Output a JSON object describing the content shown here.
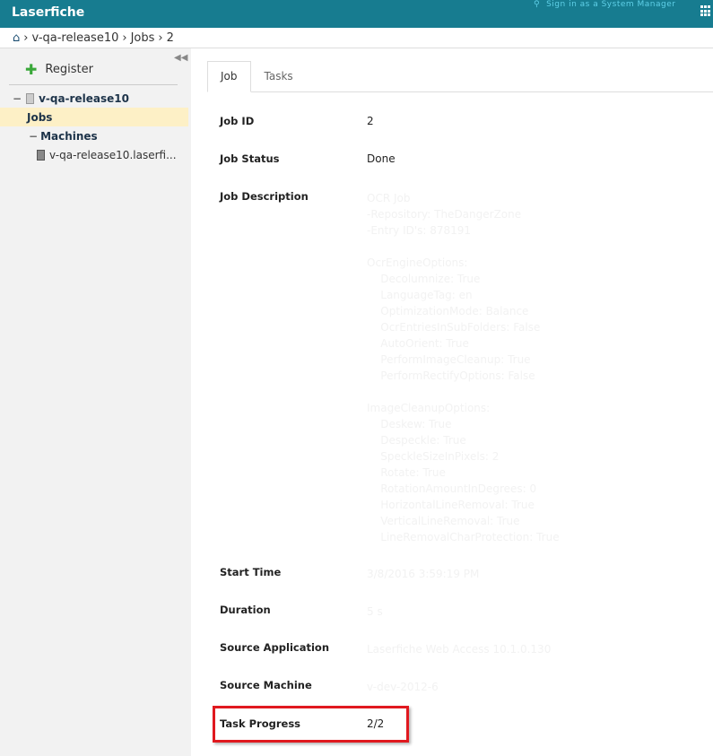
{
  "header": {
    "logo": "Laserfiche",
    "sign_in": "Sign in as a System Manager"
  },
  "breadcrumb": [
    "v-qa-release10",
    "Jobs",
    "2"
  ],
  "sidebar": {
    "register": "Register",
    "tree": {
      "server": "v-qa-release10",
      "jobs": "Jobs",
      "machines": "Machines",
      "machine": "v-qa-release10.laserfi..."
    }
  },
  "tabs": [
    "Job",
    "Tasks"
  ],
  "fields": {
    "job_id": {
      "label": "Job ID",
      "value": "2"
    },
    "job_status": {
      "label": "Job Status",
      "value": "Done"
    },
    "job_description": {
      "label": "Job Description",
      "value": "OCR Job\n-Repository: TheDangerZone\n-Entry ID's: 878191\n\nOcrEngineOptions:\n    Decolumnize: True\n    LanguageTag: en\n    OptimizationMode: Balance\n    OcrEntriesInSubFolders: False\n    AutoOrient: True\n    PerformImageCleanup: True\n    PerformRectifyOptions: False\n\nImageCleanupOptions:\n    Deskew: True\n    Despeckle: True\n    SpeckleSizeInPixels: 2\n    Rotate: True\n    RotationAmountInDegrees: 0\n    HorizontalLineRemoval: True\n    VerticalLineRemoval: True\n    LineRemovalCharProtection: True"
    },
    "start_time": {
      "label": "Start Time",
      "value": "3/8/2016 3:59:19 PM"
    },
    "duration": {
      "label": "Duration",
      "value": "5 s"
    },
    "source_application": {
      "label": "Source Application",
      "value": "Laserfiche Web Access 10.1.0.130"
    },
    "source_machine": {
      "label": "Source Machine",
      "value": "v-dev-2012-6"
    },
    "task_progress": {
      "label": "Task Progress",
      "value": "2/2"
    }
  }
}
